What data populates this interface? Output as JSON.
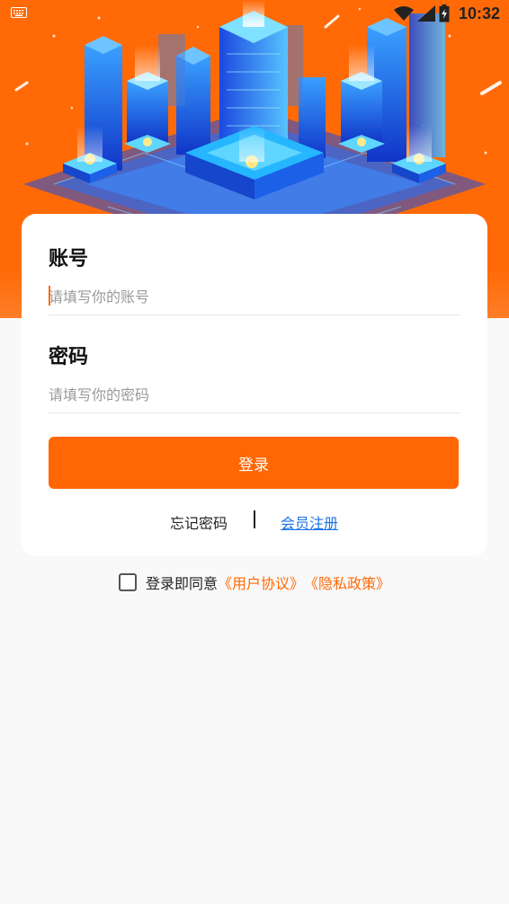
{
  "status_bar": {
    "time": "10:32",
    "icons": [
      "keyboard-icon",
      "wifi-icon",
      "cell-signal-icon",
      "battery-icon"
    ]
  },
  "hero": {
    "background_color": "#ff6a07",
    "illustration": "isometric-city-illustration"
  },
  "login_form": {
    "account_label": "账号",
    "account_placeholder": "请填写你的账号",
    "account_value": "",
    "password_label": "密码",
    "password_placeholder": "请填写你的密码",
    "password_value": "",
    "login_button": "登录",
    "forgot_password": "忘记密码",
    "register": "会员注册"
  },
  "agreement": {
    "checked": false,
    "prefix": "登录即同意",
    "user_agreement": "《用户协议》",
    "privacy_policy": "《隐私政策》"
  },
  "colors": {
    "accent": "#ff6604",
    "link": "#1a73e8",
    "page_background": "#f9f9f9"
  }
}
